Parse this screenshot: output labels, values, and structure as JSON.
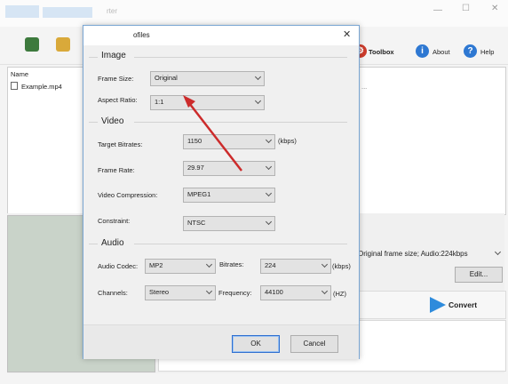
{
  "app": {
    "title": "rter",
    "toolbar": {
      "toolbox_label": "Toolbox",
      "about_label": "About",
      "help_label": "Help"
    },
    "file_list": {
      "column_name": "Name",
      "files": [
        {
          "name": "Example.mp4",
          "info": "..."
        }
      ]
    },
    "profile_summary": "Original frame size; Audio:224kbps",
    "edit_label": "Edit...",
    "convert_label": "Convert"
  },
  "dialog": {
    "title": "ofiles",
    "sections": {
      "image": "Image",
      "video": "Video",
      "audio": "Audio"
    },
    "fields": {
      "frame_size": {
        "label": "Frame Size:",
        "value": "Original"
      },
      "aspect_ratio": {
        "label": "Aspect Ratio:",
        "value": "1:1"
      },
      "target_bitrates": {
        "label": "Target Bitrates:",
        "value": "1150",
        "unit": "(kbps)"
      },
      "frame_rate": {
        "label": "Frame Rate:",
        "value": "29.97"
      },
      "video_compression": {
        "label": "Video Compression:",
        "value": "MPEG1"
      },
      "constraint": {
        "label": "Constraint:",
        "value": "NTSC"
      },
      "audio_codec": {
        "label": "Audio Codec:",
        "value": "MP2"
      },
      "audio_bitrates": {
        "label": "Bitrates:",
        "value": "224",
        "unit": "(kbps)"
      },
      "channels": {
        "label": "Channels:",
        "value": "Stereo"
      },
      "frequency": {
        "label": "Frequency:",
        "value": "44100",
        "unit": "(HZ)"
      }
    },
    "ok_label": "OK",
    "cancel_label": "Cancel"
  },
  "annotation": {
    "arrow_color": "#cc2b2b"
  },
  "colors": {
    "accent": "#2f6fd0",
    "dialog_border": "#7aa6d3"
  }
}
